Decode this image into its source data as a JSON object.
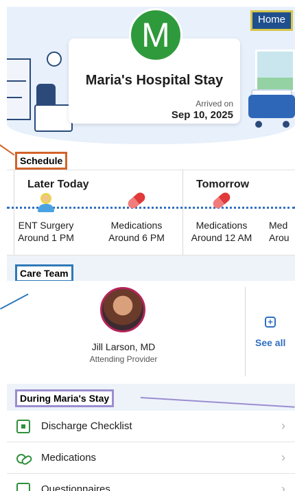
{
  "header": {
    "avatar_letter": "M",
    "title": "Maria's Hospital Stay",
    "arrived_label": "Arrived on",
    "arrived_date": "Sep 10, 2025"
  },
  "annotations": {
    "home": "Home",
    "schedule": "Schedule",
    "care_team": "Care Team",
    "during_stay": "During Maria's Stay"
  },
  "schedule": {
    "days": [
      "Later Today",
      "Tomorrow"
    ],
    "events": [
      {
        "name": "ENT Surgery",
        "time": "Around 1 PM",
        "icon": "person-icon"
      },
      {
        "name": "Medications",
        "time": "Around 6 PM",
        "icon": "pill-icon"
      },
      {
        "name": "Medications",
        "time": "Around 12 AM",
        "icon": "pill-icon"
      },
      {
        "name": "Med",
        "time": "Arou",
        "icon": "pill-icon"
      }
    ]
  },
  "care_team": {
    "provider_name": "Jill Larson, MD",
    "provider_role": "Attending Provider",
    "see_all": "See all"
  },
  "stay_list": [
    {
      "label": "Discharge Checklist",
      "icon": "checklist-icon"
    },
    {
      "label": "Medications",
      "icon": "medications-icon"
    },
    {
      "label": "Questionnaires",
      "icon": "questionnaire-icon"
    }
  ],
  "colors": {
    "accent_blue": "#2f6fc1",
    "avatar_green": "#2f9a3c",
    "schedule_tag_border": "#d2622a",
    "care_tag_border": "#2f78b8",
    "stay_tag_border": "#9a8dd0",
    "home_tag_border": "#d6c54a"
  }
}
